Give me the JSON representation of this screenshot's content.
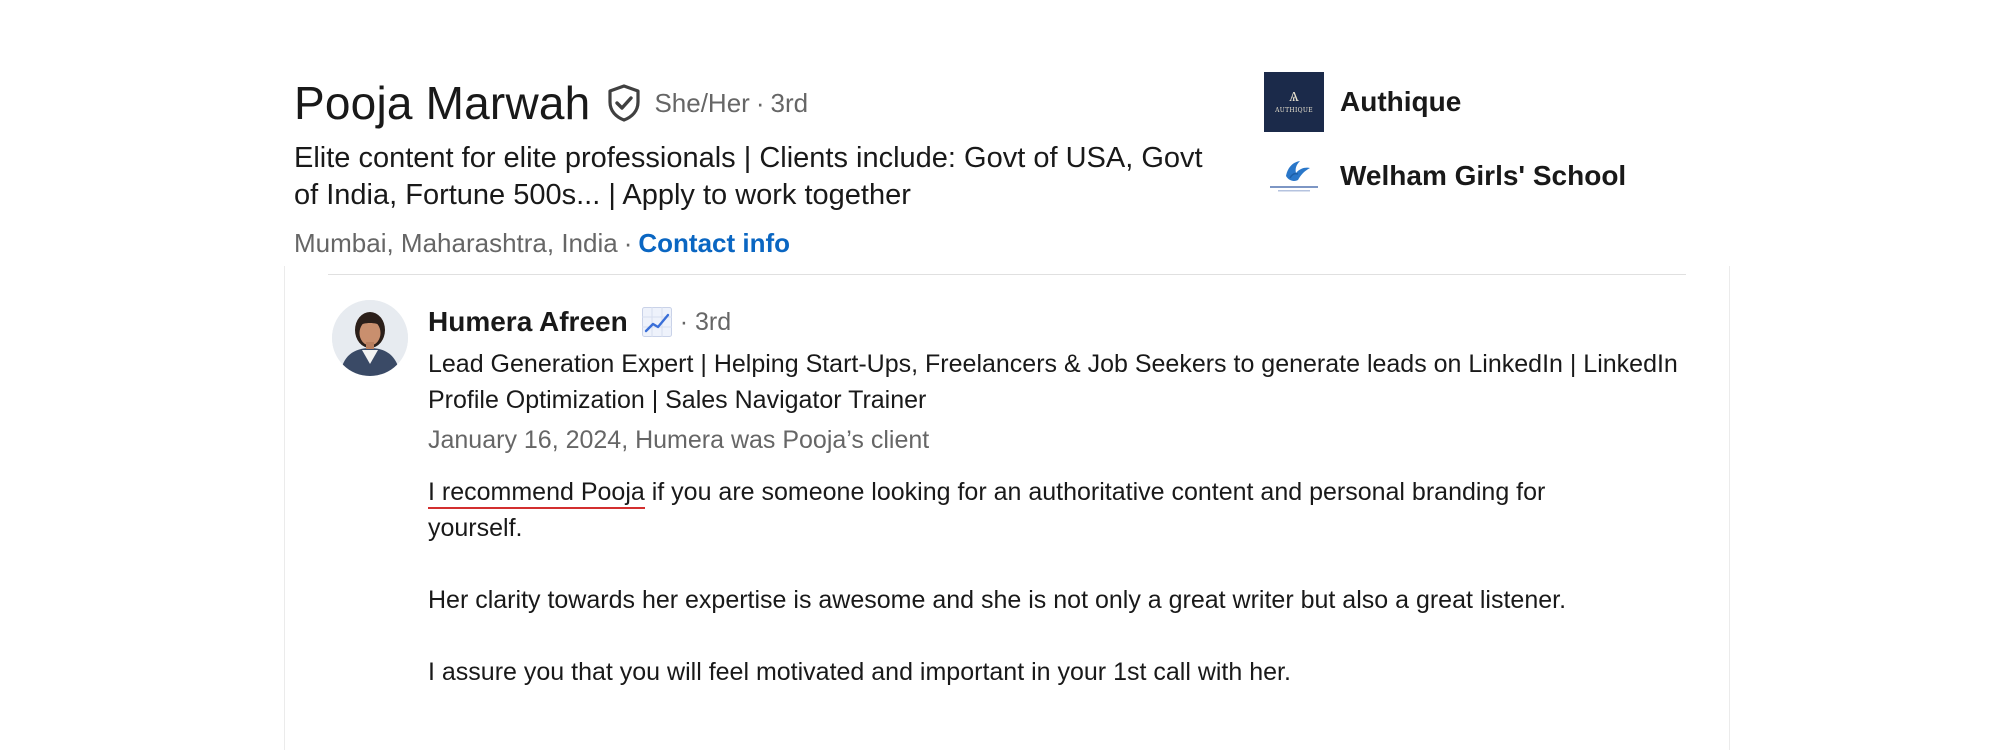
{
  "profile": {
    "name": "Pooja Marwah",
    "pronouns": "She/Her",
    "separator": "·",
    "degree": "3rd",
    "headline": "Elite content for elite professionals | Clients include: Govt of USA, Govt of India, Fortune 500s... | Apply to work together",
    "location": "Mumbai, Maharashtra, India",
    "contact_info": "Contact info"
  },
  "companies": [
    {
      "name": "Authique",
      "logo_mark": "Ѧ",
      "logo_text": "AUTHIQUE"
    },
    {
      "name": "Welham Girls' School"
    }
  ],
  "recommendation": {
    "author_name": "Humera Afreen",
    "author_degree": "· 3rd",
    "author_headline": "Lead Generation Expert | Helping Start-Ups, Freelancers & Job Seekers to generate leads on LinkedIn | LinkedIn Profile Optimization | Sales Navigator Trainer",
    "date_relation": "January 16, 2024, Humera was Pooja’s client",
    "text_underlined": "I recommend Pooja",
    "text_para1_rest": " if you are someone looking for an authoritative content and personal branding for yourself.",
    "text_para2": "Her clarity towards her expertise is awesome and she is not only a great writer but also a great listener.",
    "text_para3": "I assure you that you will feel motivated and important in your 1st call with her."
  },
  "icons": {
    "verified": "verified-shield-icon",
    "trend": "trending-chart-icon"
  },
  "colors": {
    "link": "#0a66c2",
    "secondary_text": "#666666",
    "primary_text": "#191919",
    "underline": "#d32f2f",
    "authique_bg": "#1b2a4a"
  }
}
